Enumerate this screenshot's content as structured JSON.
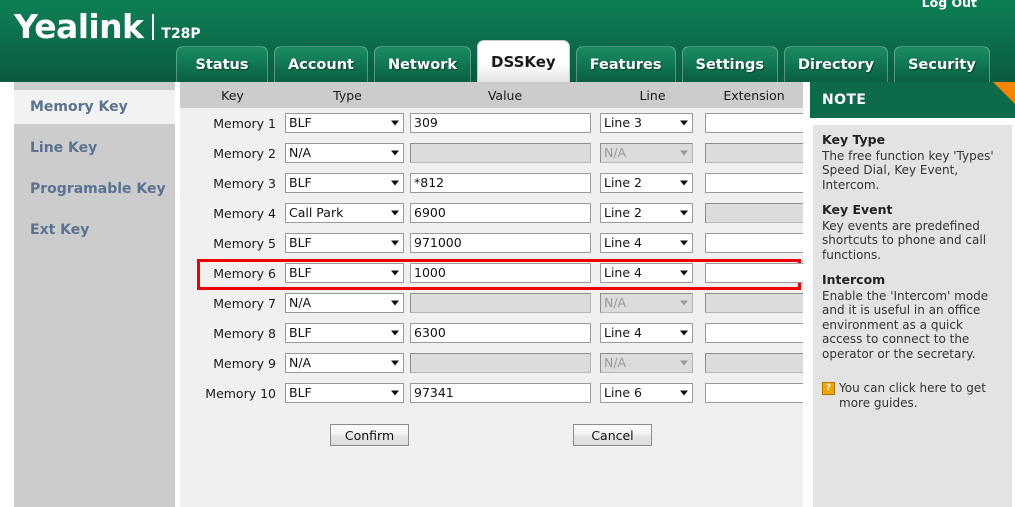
{
  "header": {
    "brand": "Yealink",
    "model": "T28P",
    "logout_label": "Log Out"
  },
  "nav": {
    "tabs": [
      {
        "label": "Status",
        "active": false
      },
      {
        "label": "Account",
        "active": false
      },
      {
        "label": "Network",
        "active": false
      },
      {
        "label": "DSSKey",
        "active": true
      },
      {
        "label": "Features",
        "active": false
      },
      {
        "label": "Settings",
        "active": false
      },
      {
        "label": "Directory",
        "active": false
      },
      {
        "label": "Security",
        "active": false
      }
    ]
  },
  "sidebar": {
    "items": [
      {
        "label": "Memory Key",
        "active": true
      },
      {
        "label": "Line Key",
        "active": false
      },
      {
        "label": "Programable Key",
        "active": false
      },
      {
        "label": "Ext Key",
        "active": false
      }
    ]
  },
  "table": {
    "headers": {
      "key": "Key",
      "type": "Type",
      "value": "Value",
      "line": "Line",
      "extension": "Extension"
    },
    "rows": [
      {
        "key": "Memory 1",
        "type": "BLF",
        "value": "309",
        "line": "Line 3",
        "extension": "",
        "disabled": false,
        "ext_disabled": false,
        "highlighted": false
      },
      {
        "key": "Memory 2",
        "type": "N/A",
        "value": "",
        "line": "N/A",
        "extension": "",
        "disabled": true,
        "ext_disabled": true,
        "highlighted": false
      },
      {
        "key": "Memory 3",
        "type": "BLF",
        "value": "*812",
        "line": "Line 2",
        "extension": "",
        "disabled": false,
        "ext_disabled": false,
        "highlighted": false
      },
      {
        "key": "Memory 4",
        "type": "Call Park",
        "value": "6900",
        "line": "Line 2",
        "extension": "",
        "disabled": false,
        "ext_disabled": true,
        "highlighted": false
      },
      {
        "key": "Memory 5",
        "type": "BLF",
        "value": "971000",
        "line": "Line 4",
        "extension": "",
        "disabled": false,
        "ext_disabled": false,
        "highlighted": true
      },
      {
        "key": "Memory 6",
        "type": "BLF",
        "value": "1000",
        "line": "Line 4",
        "extension": "",
        "disabled": false,
        "ext_disabled": false,
        "highlighted": false
      },
      {
        "key": "Memory 7",
        "type": "N/A",
        "value": "",
        "line": "N/A",
        "extension": "",
        "disabled": true,
        "ext_disabled": true,
        "highlighted": false
      },
      {
        "key": "Memory 8",
        "type": "BLF",
        "value": "6300",
        "line": "Line 4",
        "extension": "",
        "disabled": false,
        "ext_disabled": false,
        "highlighted": false
      },
      {
        "key": "Memory 9",
        "type": "N/A",
        "value": "",
        "line": "N/A",
        "extension": "",
        "disabled": true,
        "ext_disabled": true,
        "highlighted": false
      },
      {
        "key": "Memory 10",
        "type": "BLF",
        "value": "97341",
        "line": "Line 6",
        "extension": "",
        "disabled": false,
        "ext_disabled": false,
        "highlighted": false
      }
    ]
  },
  "buttons": {
    "confirm": "Confirm",
    "cancel": "Cancel"
  },
  "note": {
    "panel_title": "NOTE",
    "sections": [
      {
        "title": "Key Type",
        "text": "The free function key 'Types' Speed Dial, Key Event, Intercom."
      },
      {
        "title": "Key Event",
        "text": "Key events are predefined shortcuts to phone and call functions."
      },
      {
        "title": "Intercom",
        "text": "Enable the 'Intercom' mode and it is useful in an office environment as a quick access to connect to the operator or the secretary."
      }
    ],
    "help_icon": "help-question-icon",
    "help_text": "You can click here to get more guides."
  },
  "colors": {
    "brand_green": "#0d6b4a",
    "header_green": "#0a7f52",
    "accent_orange": "#f58400",
    "highlight_red": "#ee0000",
    "sidebar_gray": "#cccccc",
    "content_gray": "#f0f0f0",
    "sidebar_text": "#5a7292"
  }
}
